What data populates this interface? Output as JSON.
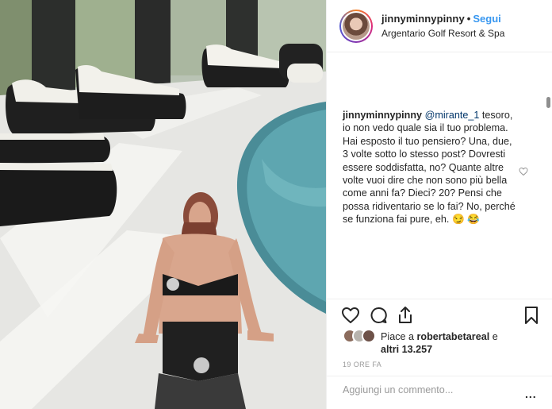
{
  "post": {
    "photo_icon": "post-photo-poolside"
  },
  "header": {
    "username": "jinnyminnypinny",
    "separator": "•",
    "follow_label": "Segui",
    "location": "Argentario Golf Resort & Spa"
  },
  "comment": {
    "username": "jinnyminnypinny",
    "mention": "@mirante_1",
    "text": " tesoro, io non vedo quale sia il tuo problema. Hai esposto il tuo pensiero? Una, due, 3 volte sotto lo stesso post? Dovresti essere soddisfatta, no? Quante altre volte vuoi dire che non sono più bella come anni fa? Dieci? 20? Pensi che possa ridiventario se lo fai? No, perché se funziona fai pure, eh.",
    "emoji": "😏 😂"
  },
  "actions": {
    "icons": [
      "heart-icon",
      "comment-icon",
      "share-icon",
      "bookmark-icon"
    ]
  },
  "likes": {
    "prefix": "Piace a ",
    "user": "robertabetareal",
    "middle": " e",
    "others": "altri 13.257"
  },
  "timestamp": "19 ORE FA",
  "add_comment": {
    "placeholder": "Aggiungi un commento...",
    "more_label": "..."
  },
  "colors": {
    "link": "#3897f0",
    "text": "#262626",
    "muted": "#999999",
    "border": "#efefef"
  }
}
